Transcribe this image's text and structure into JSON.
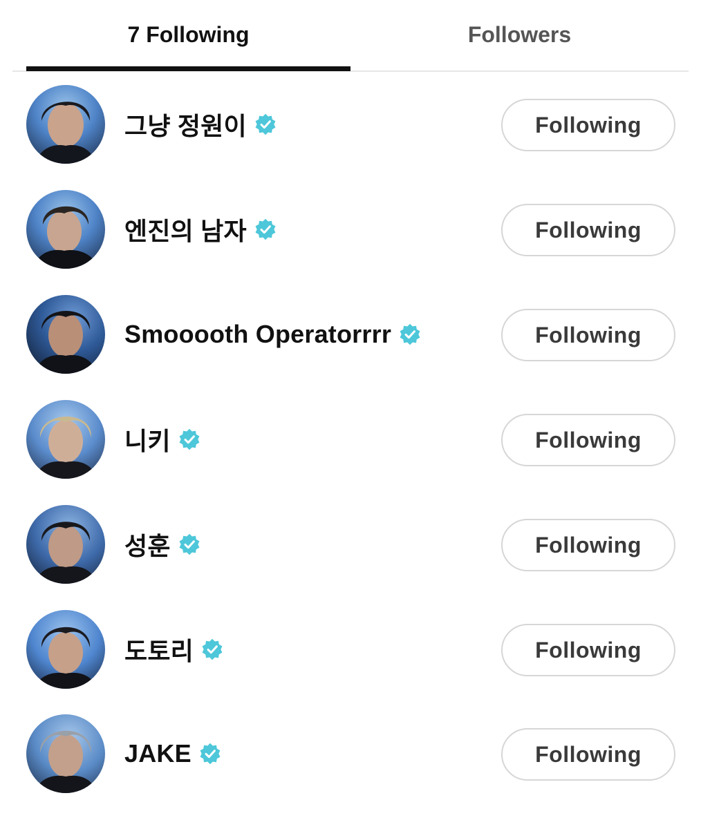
{
  "tabs": {
    "following_label": "7 Following",
    "followers_label": "Followers",
    "active": "following"
  },
  "colors": {
    "verified_badge": "#4dc7d9",
    "tab_indicator": "#111111",
    "button_border": "#d6d6d6"
  },
  "following": [
    {
      "name": "그냥 정원이",
      "verified": true,
      "button_label": "Following"
    },
    {
      "name": "엔진의 남자",
      "verified": true,
      "button_label": "Following"
    },
    {
      "name": "Smooooth Operatorrrr",
      "verified": true,
      "button_label": "Following"
    },
    {
      "name": "니키",
      "verified": true,
      "button_label": "Following"
    },
    {
      "name": "성훈",
      "verified": true,
      "button_label": "Following"
    },
    {
      "name": "도토리",
      "verified": true,
      "button_label": "Following"
    },
    {
      "name": "JAKE",
      "verified": true,
      "button_label": "Following"
    }
  ]
}
